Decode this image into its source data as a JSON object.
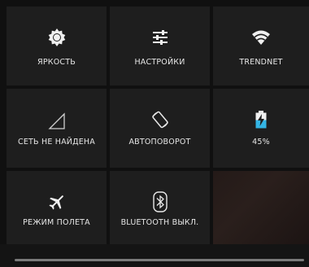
{
  "tiles": {
    "brightness": {
      "label": "ЯРКОСТЬ",
      "icon": "brightness-icon"
    },
    "settings": {
      "label": "НАСТРОЙКИ",
      "icon": "sliders-icon"
    },
    "wifi": {
      "label": "TRENDNET",
      "icon": "wifi-icon"
    },
    "network": {
      "label": "СЕТЬ НЕ НАЙДЕНА",
      "icon": "signal-empty-icon"
    },
    "autorotate": {
      "label": "АВТОПОВОРОТ",
      "icon": "rotate-icon"
    },
    "battery": {
      "label": "45%",
      "icon": "battery-charging-icon",
      "level": 0.45
    },
    "airplane": {
      "label": "РЕЖИМ ПОЛЕТА",
      "icon": "airplane-icon"
    },
    "bluetooth": {
      "label": "BLUETOOTH ВЫКЛ.",
      "icon": "bluetooth-icon"
    }
  },
  "colors": {
    "tile_bg": "#1e1e1e",
    "text": "#e6e6e6",
    "battery_accent": "#33b5e5"
  }
}
